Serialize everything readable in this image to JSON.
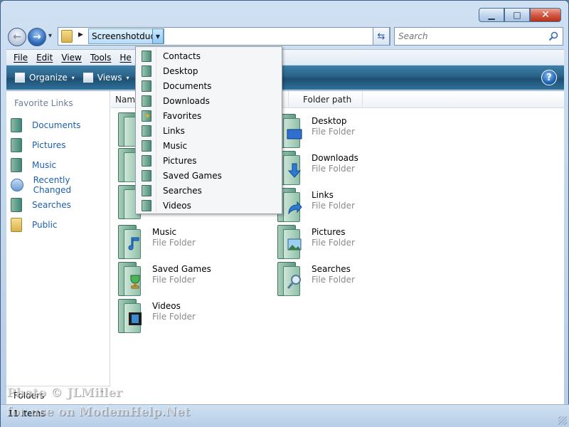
{
  "window": {
    "minimize_glyph": "▁",
    "maximize_glyph": "□",
    "close_glyph": "✕"
  },
  "nav": {
    "back_glyph": "←",
    "forward_glyph": "→",
    "history_glyph": "▾"
  },
  "address": {
    "breadcrumb": "Screenshotdude",
    "crumb_separator": "▶",
    "dropdown_glyph": "▼",
    "end_glyph": "▼",
    "refresh_glyph": "⇆"
  },
  "search": {
    "placeholder": "Search",
    "icon": "search-icon"
  },
  "menu": {
    "file": "File",
    "edit": "Edit",
    "view": "View",
    "tools": "Tools",
    "help": "He"
  },
  "command_bar": {
    "organize": "Organize",
    "views": "Views",
    "chevron": "▾",
    "help_glyph": "?"
  },
  "nav_pane": {
    "heading": "Favorite Links",
    "items": [
      {
        "label": "Documents",
        "icon": "documents-icon"
      },
      {
        "label": "Pictures",
        "icon": "pictures-icon"
      },
      {
        "label": "Music",
        "icon": "music-icon"
      },
      {
        "label": "Recently Changed",
        "icon": "recently-changed-icon"
      },
      {
        "label": "Searches",
        "icon": "searches-icon"
      },
      {
        "label": "Public",
        "icon": "public-folder-icon"
      }
    ],
    "folders_label": "Folders",
    "folders_chevron": "⌃"
  },
  "columns": {
    "name": "Name",
    "folder_path": "Folder path"
  },
  "files": [
    {
      "name": "Desktop",
      "type": "File Folder"
    },
    {
      "name": "Downloads",
      "type": "File Folder"
    },
    {
      "name": "Links",
      "type": "File Folder"
    },
    {
      "name": "Music",
      "type": "File Folder"
    },
    {
      "name": "Pictures",
      "type": "File Folder"
    },
    {
      "name": "Saved Games",
      "type": "File Folder"
    },
    {
      "name": "Searches",
      "type": "File Folder"
    },
    {
      "name": "Videos",
      "type": "File Folder"
    }
  ],
  "dropdown": {
    "items": [
      {
        "label": "Contacts",
        "icon": "contacts-icon"
      },
      {
        "label": "Desktop",
        "icon": "desktop-icon"
      },
      {
        "label": "Documents",
        "icon": "documents-icon"
      },
      {
        "label": "Downloads",
        "icon": "downloads-icon"
      },
      {
        "label": "Favorites",
        "icon": "favorites-icon"
      },
      {
        "label": "Links",
        "icon": "links-icon"
      },
      {
        "label": "Music",
        "icon": "music-icon"
      },
      {
        "label": "Pictures",
        "icon": "pictures-icon"
      },
      {
        "label": "Saved Games",
        "icon": "saved-games-icon"
      },
      {
        "label": "Searches",
        "icon": "searches-icon"
      },
      {
        "label": "Videos",
        "icon": "videos-icon"
      }
    ]
  },
  "status": {
    "item_count": "11 items"
  },
  "watermark": {
    "line1": "Photo © JLMiller",
    "line2": "for use on ModemHelp.Net"
  },
  "colors": {
    "link": "#1c5fae",
    "command_bar": "#2a6288",
    "selection": "#b9dcf5"
  }
}
